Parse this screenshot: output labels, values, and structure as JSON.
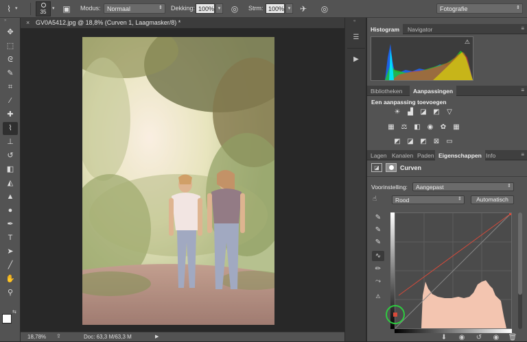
{
  "options_bar": {
    "brush_size": "35",
    "mode_label": "Modus:",
    "mode_value": "Normaal",
    "opacity_label": "Dekking:",
    "opacity_value": "100%",
    "flow_label": "Strm:",
    "flow_value": "100%",
    "workspace": "Fotografie"
  },
  "toolbar": {
    "tools": [
      {
        "name": "move-tool",
        "glyph": "✥"
      },
      {
        "name": "marquee-tool",
        "glyph": "⬚"
      },
      {
        "name": "lasso-tool",
        "glyph": "ᘓ"
      },
      {
        "name": "quick-select-tool",
        "glyph": "✎"
      },
      {
        "name": "crop-tool",
        "glyph": "⌗"
      },
      {
        "name": "eyedropper-tool",
        "glyph": "⁄"
      },
      {
        "name": "healing-tool",
        "glyph": "✚"
      },
      {
        "name": "brush-tool",
        "glyph": "⌇"
      },
      {
        "name": "stamp-tool",
        "glyph": "⊥"
      },
      {
        "name": "history-brush-tool",
        "glyph": "↺"
      },
      {
        "name": "eraser-tool",
        "glyph": "◧"
      },
      {
        "name": "bucket-tool",
        "glyph": "◭"
      },
      {
        "name": "blur-tool",
        "glyph": "▲"
      },
      {
        "name": "dodge-tool",
        "glyph": "●"
      },
      {
        "name": "pen-tool",
        "glyph": "✒"
      },
      {
        "name": "type-tool",
        "glyph": "T"
      },
      {
        "name": "path-select-tool",
        "glyph": "➤"
      },
      {
        "name": "line-tool",
        "glyph": "╱"
      },
      {
        "name": "hand-tool",
        "glyph": "✋"
      },
      {
        "name": "zoom-tool",
        "glyph": "⚲"
      }
    ]
  },
  "document": {
    "close": "×",
    "title": "GV0A5412.jpg @ 18,8% (Curven 1, Laagmasker/8) *"
  },
  "status": {
    "zoom": "18,78%",
    "doc": "Doc: 63,3 M/63,3 M"
  },
  "histogram_panel": {
    "tabs": [
      "Histogram",
      "Navigator"
    ],
    "warning": "⚠"
  },
  "adjustments_panel": {
    "tabs": [
      "Bibliotheken",
      "Aanpassingen"
    ],
    "heading": "Een aanpassing toevoegen"
  },
  "properties_panel": {
    "tabs": [
      "Lagen",
      "Kanalen",
      "Paden",
      "Eigenschappen",
      "Info"
    ],
    "title": "Curven",
    "preset_label": "Voorinstelling:",
    "preset_value": "Aangepast",
    "channel_value": "Rood",
    "auto_button": "Automatisch"
  },
  "colors": {
    "ui_bg": "#535353",
    "canvas_bg": "#282828",
    "curve_line": "#d94a3a",
    "histogram_fill": "#f3c5b0",
    "point_ring": "#2ecc40"
  }
}
